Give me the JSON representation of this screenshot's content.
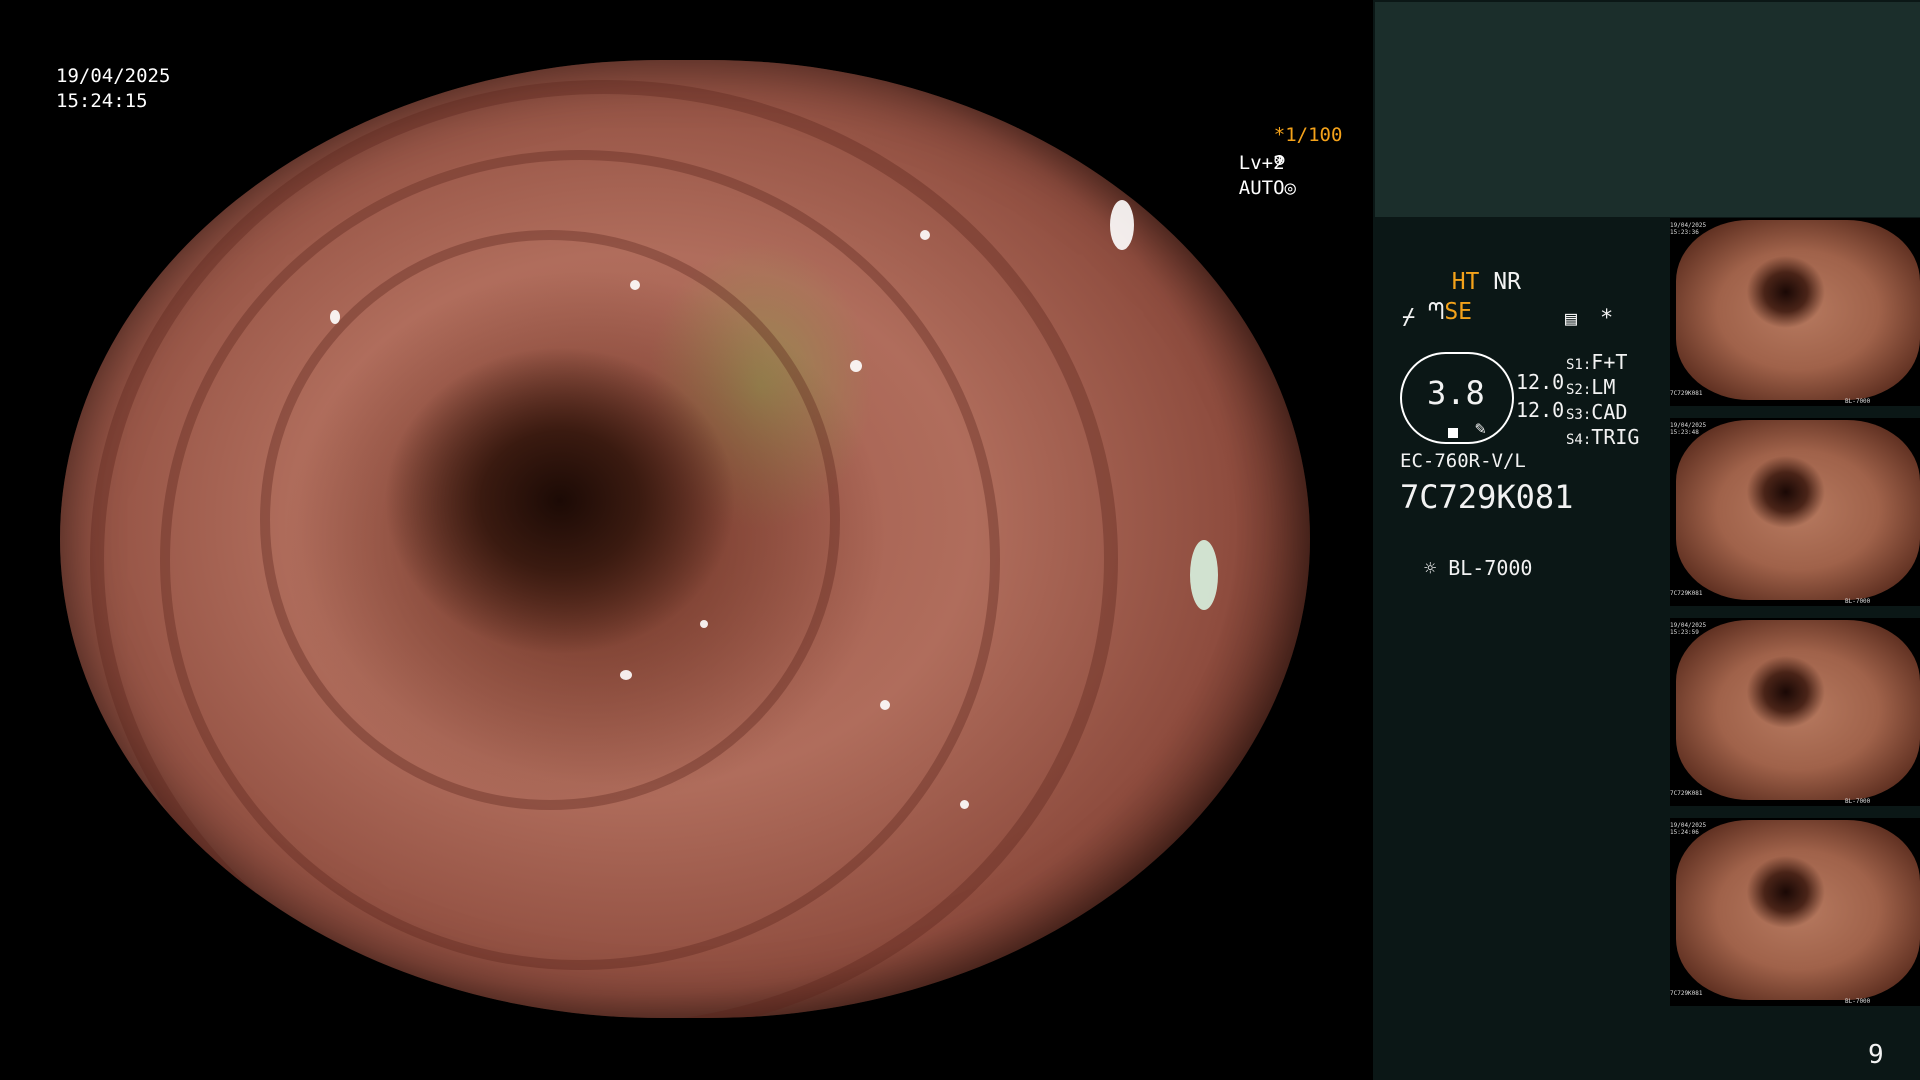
{
  "overlay": {
    "date": "19/04/2025",
    "time": "15:24:15",
    "magnification": "*1/100",
    "level": "Lv+2",
    "mode": "AUTO"
  },
  "panel": {
    "ht": "HT",
    "nr": "NR",
    "se": "SE",
    "octagon_value": "3.8",
    "values": [
      "12.0",
      "12.0"
    ],
    "settings": [
      {
        "key": "S1:",
        "value": "F+T"
      },
      {
        "key": "S2:",
        "value": "LM"
      },
      {
        "key": "S3:",
        "value": "CAD"
      },
      {
        "key": "S4:",
        "value": "TRIG"
      }
    ],
    "scope_model": "EC-760R-V/L",
    "serial": "7C729K081",
    "light_source": "BL-7000",
    "asterisk": "*",
    "page_number": "9"
  },
  "thumbnails": [
    {
      "date": "19/04/2025",
      "time": "15:23:36",
      "serial": "7C729K081",
      "light": "BL-7000"
    },
    {
      "date": "19/04/2025",
      "time": "15:23:48",
      "serial": "7C729K081",
      "light": "BL-7000"
    },
    {
      "date": "19/04/2025",
      "time": "15:23:59",
      "serial": "7C729K081",
      "light": "BL-7000"
    },
    {
      "date": "19/04/2025",
      "time": "15:24:06",
      "serial": "7C729K081",
      "light": "BL-7000"
    }
  ],
  "colors": {
    "accent_orange": "#f4a21a",
    "panel_bg": "#0b1716",
    "panel_top_bg": "#1b2e2b"
  }
}
